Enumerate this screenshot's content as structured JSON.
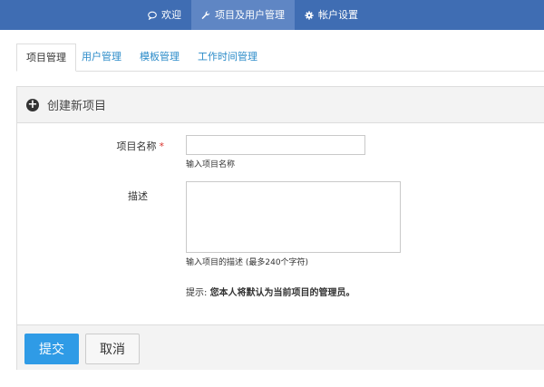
{
  "topnav": {
    "items": [
      {
        "label": "欢迎",
        "icon": "comment-icon",
        "active": false
      },
      {
        "label": "项目及用户管理",
        "icon": "wrench-icon",
        "active": true
      },
      {
        "label": "帐户设置",
        "icon": "gear-icon",
        "active": false
      }
    ],
    "bg_color": "#3f6db3",
    "active_color": "#5f86c4"
  },
  "tabs": [
    {
      "label": "项目管理",
      "active": true
    },
    {
      "label": "用户管理",
      "active": false
    },
    {
      "label": "模板管理",
      "active": false
    },
    {
      "label": "工作时间管理",
      "active": false
    }
  ],
  "panel": {
    "title": "创建新项目",
    "icon": "plus-circle-icon",
    "fields": {
      "name": {
        "label": "项目名称",
        "required_mark": "*",
        "value": "",
        "help": "输入项目名称"
      },
      "description": {
        "label": "描述",
        "value": "",
        "help": "输入项目的描述 (最多240个字符)"
      }
    },
    "hint": {
      "prefix": "提示: ",
      "text": "您本人将默认为当前项目的管理员。"
    },
    "buttons": {
      "submit": "提交",
      "cancel": "取消"
    }
  },
  "colors": {
    "primary_button": "#2f9be6",
    "link": "#2b8bc9",
    "required": "#d9322b"
  }
}
